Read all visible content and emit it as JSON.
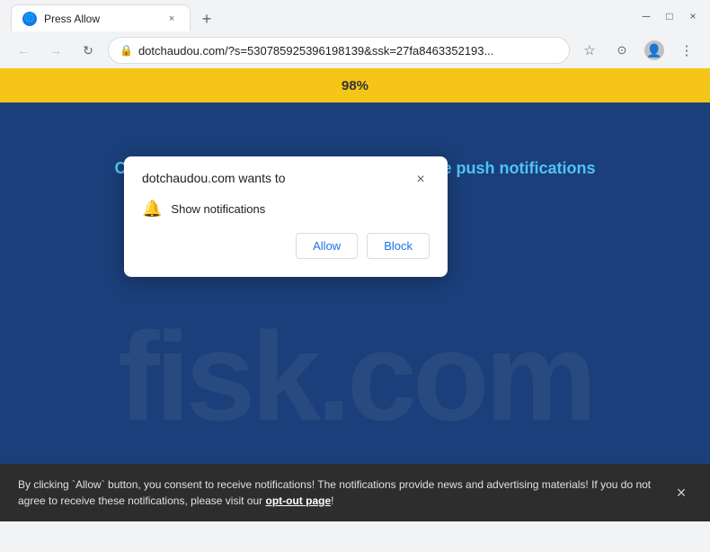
{
  "browser": {
    "tab": {
      "favicon_label": "⊕",
      "title": "Press Allow",
      "close_label": "×",
      "new_tab_label": "+"
    },
    "nav": {
      "back_label": "←",
      "forward_label": "→",
      "reload_label": "↻",
      "url": "dotchaudou.com/?s=530785925396198139&ssk=27fa8463352193...",
      "lock_icon": "🔒",
      "star_label": "☆",
      "downloads_label": "⊙",
      "profile_label": "👤",
      "menu_label": "⋮"
    },
    "window_controls": {
      "minimize": "─",
      "maximize": "□",
      "close": "×"
    }
  },
  "permission_popup": {
    "title": "dotchaudou.com wants to",
    "close_label": "×",
    "bell_icon": "🔔",
    "permission_text": "Show notifications",
    "allow_label": "Allow",
    "block_label": "Block"
  },
  "page": {
    "progress_percent": "98%",
    "message": "Click the «Allow» button to subscribe to the push notifications and continue watching",
    "watermark": "fisk.com",
    "background_color": "#1a3a6b"
  },
  "bottom_banner": {
    "text": "By clicking `Allow` button, you consent to receive notifications! The notifications provide news and advertising materials! If you do not agree to receive these notifications, please visit our ",
    "link_text": "opt-out page",
    "text_end": "!",
    "close_label": "×"
  }
}
